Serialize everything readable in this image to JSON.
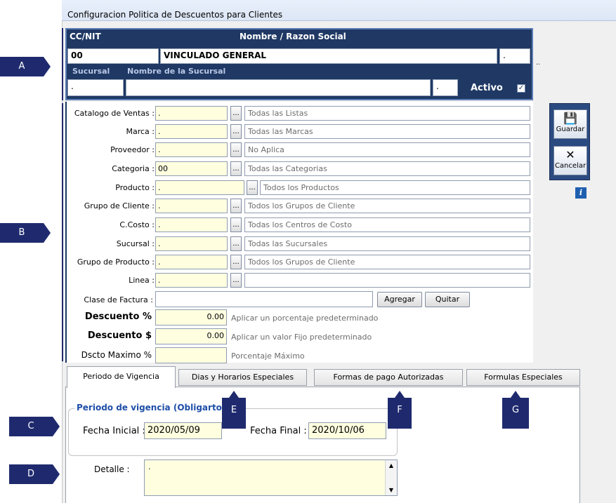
{
  "window": {
    "title": "Configuracion Politica de Descuentos para Clientes"
  },
  "header": {
    "ccnit_label": "CC/NIT",
    "nombre_label": "Nombre / Razon Social",
    "ccnit_value": "00",
    "nombre_value": "VINCULADO GENERAL",
    "nombre_extra": ".",
    "trailing_dots": "..",
    "sucursal_label": "Sucursal",
    "nombre_sucursal_label": "Nombre de la Sucursal",
    "sucursal_value": ".",
    "nombre_sucursal_value": "",
    "sucursal_extra": ".",
    "activo_label": "Activo",
    "activo_checked": "✓"
  },
  "form": {
    "rows": [
      {
        "label": "Catalogo de Ventas :",
        "value": ".",
        "desc": "Todas las Listas"
      },
      {
        "label": "Marca :",
        "value": ".",
        "desc": "Todas las Marcas"
      },
      {
        "label": "Proveedor :",
        "value": ".",
        "desc": "No Aplica"
      },
      {
        "label": "Categoria :",
        "value": "00",
        "desc": "Todas las Categorias"
      },
      {
        "label": "Producto :",
        "value": ".",
        "desc": "Todos los Productos"
      },
      {
        "label": "Grupo de Cliente :",
        "value": ".",
        "desc": "Todos los Grupos de Cliente"
      },
      {
        "label": "C.Costo :",
        "value": ".",
        "desc": "Todas los Centros de Costo"
      },
      {
        "label": "Sucursal :",
        "value": ".",
        "desc": "Todas las Sucursales"
      },
      {
        "label": "Grupo de Producto :",
        "value": ".",
        "desc": "Todos los Grupos de Cliente"
      },
      {
        "label": "Linea :",
        "value": ".",
        "desc": ""
      }
    ],
    "dots_label": "...",
    "clase_factura_label": "Clase de Factura :",
    "clase_factura_value": "",
    "agregar_label": "Agregar",
    "quitar_label": "Quitar",
    "descuento_pct_label": "Descuento %",
    "descuento_pct_value": "0.00",
    "descuento_pct_hint": "Aplicar un porcentaje predeterminado",
    "descuento_val_label": "Descuento $",
    "descuento_val_value": "0.00",
    "descuento_val_hint": "Aplicar un valor Fijo predeterminado",
    "dscto_max_label": "Dscto Maximo %",
    "dscto_max_value": "",
    "dscto_max_hint": "Porcentaje Máximo"
  },
  "side_buttons": {
    "guardar_label": "Guardar",
    "cancelar_label": "Cancelar",
    "info_label": "i"
  },
  "tabs": [
    {
      "label": "Periodo de  Vigencia",
      "active": true
    },
    {
      "label": "Dias y Horarios Especiales",
      "active": false
    },
    {
      "label": "Formas de pago Autorizadas",
      "active": false
    },
    {
      "label": "Formulas Especiales",
      "active": false
    }
  ],
  "vigencia": {
    "group_title": "Periodo de vigencia  (Obligartori",
    "fecha_inicial_label": "Fecha Inicial :",
    "fecha_inicial_value": "2020/05/09",
    "fecha_final_label": "Fecha Final :",
    "fecha_final_value": "2020/10/06",
    "detalle_label": "Detalle :",
    "detalle_value": "."
  },
  "markers": {
    "a": "A",
    "b": "B",
    "c": "C",
    "d": "D",
    "e": "E",
    "f": "F",
    "g": "G"
  },
  "colors": {
    "header_bg": "#1f3864",
    "field_yellow": "#ffffe0",
    "marker": "#1f2a6e"
  }
}
